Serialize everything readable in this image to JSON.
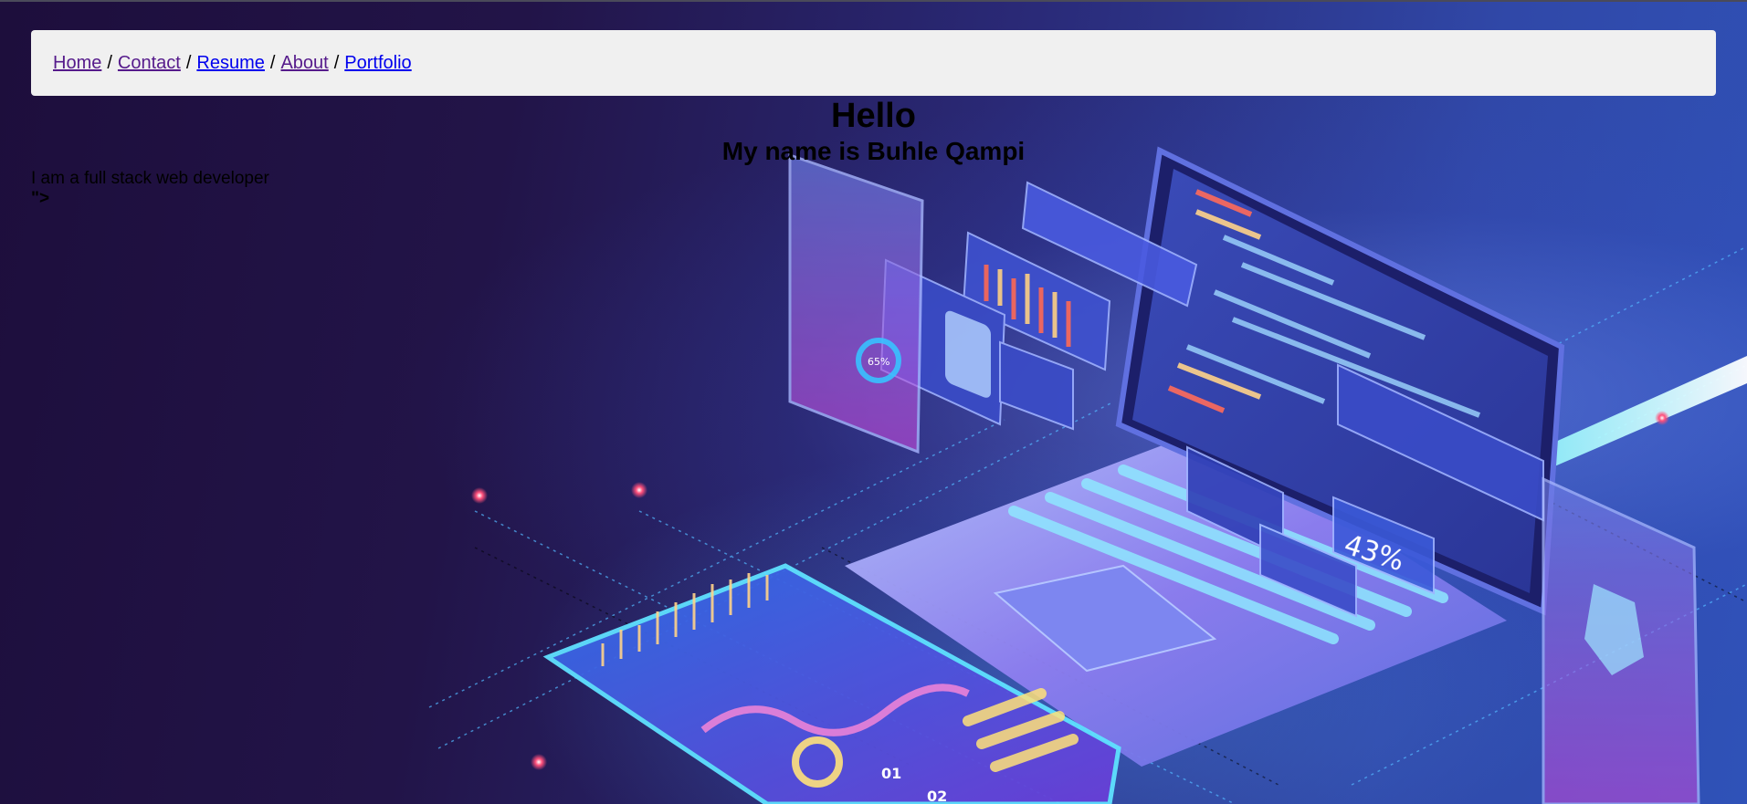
{
  "nav": {
    "links": [
      {
        "label": "Home",
        "visited": true
      },
      {
        "label": "Contact",
        "visited": true
      },
      {
        "label": "Resume",
        "visited": false
      },
      {
        "label": "About",
        "visited": true
      },
      {
        "label": "Portfolio",
        "visited": false
      }
    ],
    "separator": "/"
  },
  "hero": {
    "greeting": "Hello",
    "name_line": "My name is Buhle Qampi",
    "tagline": "I am a full stack web developer",
    "stray_text": "\">"
  },
  "artwork": {
    "progress_readout": "43%",
    "phone_badge": "65%",
    "tablet_badge_1": "01",
    "tablet_badge_2": "02"
  },
  "colors": {
    "nav_bg": "#f0f0f0",
    "link_visited": "#551a8b",
    "link_unvisited": "#0000ee",
    "bg_dark": "#1d0e3c",
    "bg_blue": "#3048a8",
    "neon_pink": "#ff3ad7",
    "neon_cyan": "#5fe1ff"
  }
}
